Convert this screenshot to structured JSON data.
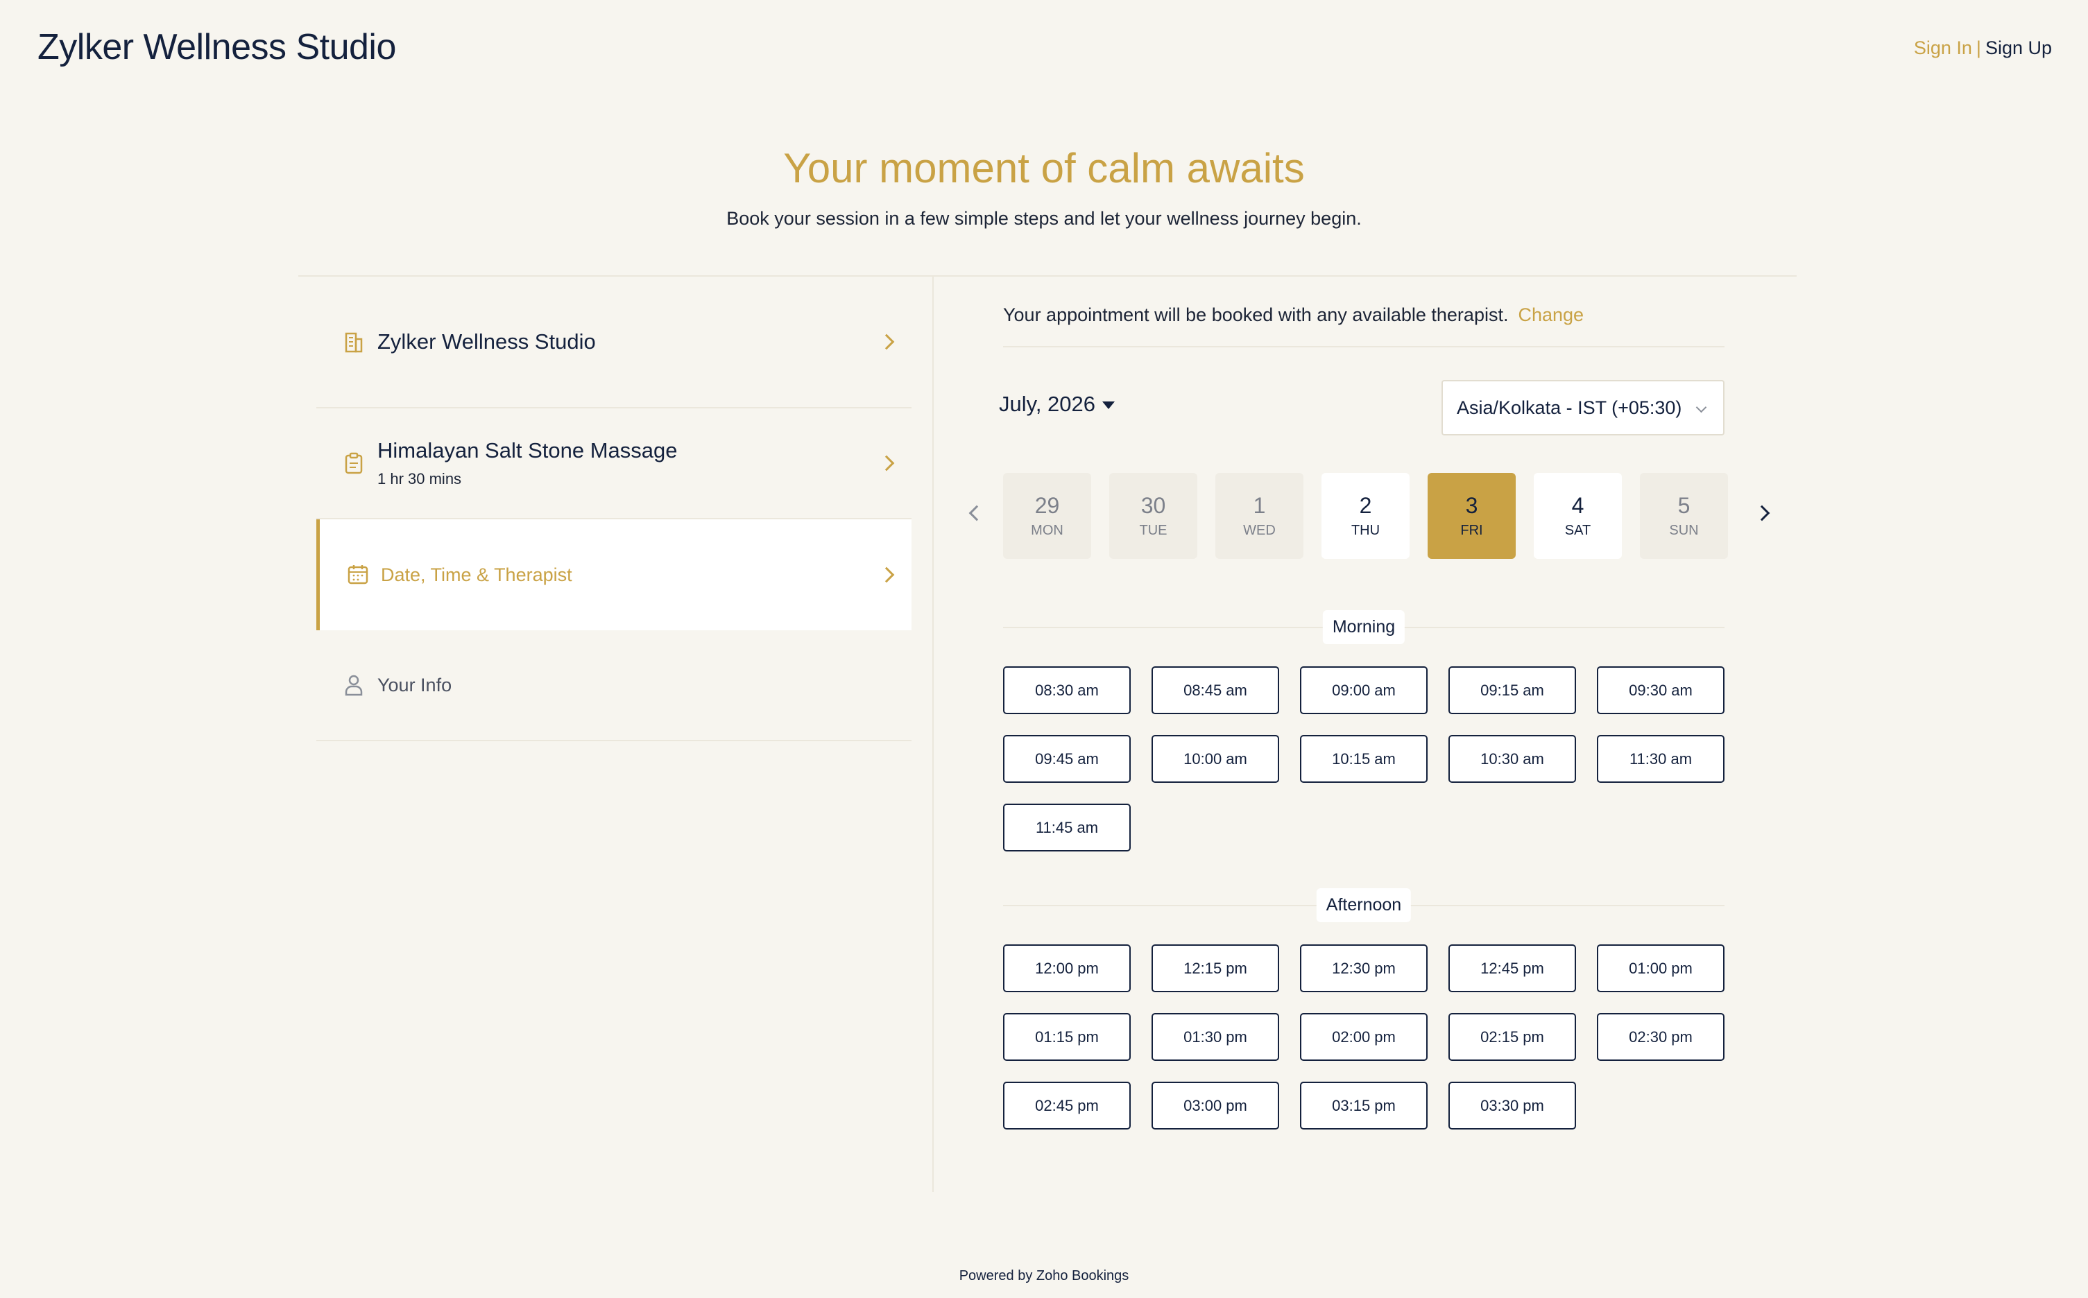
{
  "header": {
    "brand": "Zylker Wellness Studio",
    "sign_in": "Sign In",
    "separator": "|",
    "sign_up": "Sign Up"
  },
  "hero": {
    "title": "Your moment of calm awaits",
    "subtitle": "Book your session in a few simple steps and let your wellness journey begin."
  },
  "steps": [
    {
      "label": "Zylker Wellness Studio",
      "icon": "building-icon"
    },
    {
      "label": "Himalayan Salt Stone Massage",
      "sub": "1 hr 30 mins",
      "icon": "clipboard-icon"
    },
    {
      "label": "Date, Time & Therapist",
      "icon": "calendar-icon",
      "active": true
    },
    {
      "label": "Your Info",
      "icon": "user-icon"
    }
  ],
  "booking": {
    "notice": "Your appointment will be booked with any available therapist.",
    "change": "Change",
    "month": "July, 2026",
    "timezone": "Asia/Kolkata - IST (+05:30)",
    "days": [
      {
        "num": "29",
        "dow": "MON"
      },
      {
        "num": "30",
        "dow": "TUE"
      },
      {
        "num": "1",
        "dow": "WED"
      },
      {
        "num": "2",
        "dow": "THU"
      },
      {
        "num": "3",
        "dow": "FRI"
      },
      {
        "num": "4",
        "dow": "SAT"
      },
      {
        "num": "5",
        "dow": "SUN"
      }
    ],
    "morning_label": "Morning",
    "morning": [
      "08:30 am",
      "08:45 am",
      "09:00 am",
      "09:15 am",
      "09:30 am",
      "09:45 am",
      "10:00 am",
      "10:15 am",
      "10:30 am",
      "11:30 am",
      "11:45 am"
    ],
    "afternoon_label": "Afternoon",
    "afternoon": [
      "12:00 pm",
      "12:15 pm",
      "12:30 pm",
      "12:45 pm",
      "01:00 pm",
      "01:15 pm",
      "01:30 pm",
      "02:00 pm",
      "02:15 pm",
      "02:30 pm",
      "02:45 pm",
      "03:00 pm",
      "03:15 pm",
      "03:30 pm"
    ]
  },
  "footer": "Powered by Zoho Bookings",
  "colors": {
    "accent": "#c9a245",
    "text": "#14213d",
    "background": "#f7f5ef"
  }
}
